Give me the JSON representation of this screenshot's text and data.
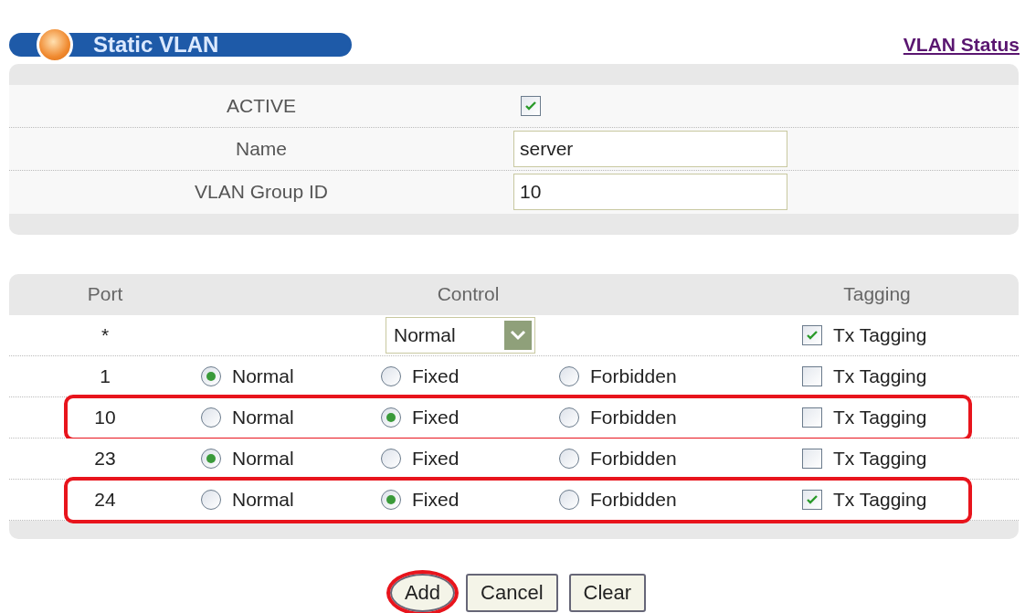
{
  "title": "Static VLAN",
  "status_link": "VLAN Status",
  "settings": [
    {
      "kind": "checkbox",
      "label": "ACTIVE",
      "checked": true
    },
    {
      "kind": "text",
      "label": "Name",
      "value": "server"
    },
    {
      "kind": "text",
      "label": "VLAN Group ID",
      "value": "10"
    }
  ],
  "ports_table": {
    "columns": [
      "Port",
      "Control",
      "Tagging"
    ],
    "rows": [
      {
        "kind": "all",
        "port": "*",
        "select_value": "Normal",
        "tagging": {
          "label": "Tx Tagging",
          "checked": true
        },
        "highlighted": false
      },
      {
        "kind": "port",
        "port": "1",
        "options": [
          {
            "label": "Normal",
            "selected": true
          },
          {
            "label": "Fixed",
            "selected": false
          },
          {
            "label": "Forbidden",
            "selected": false
          }
        ],
        "tagging": {
          "label": "Tx Tagging",
          "checked": false
        },
        "highlighted": false
      },
      {
        "kind": "port",
        "port": "10",
        "options": [
          {
            "label": "Normal",
            "selected": false
          },
          {
            "label": "Fixed",
            "selected": true
          },
          {
            "label": "Forbidden",
            "selected": false
          }
        ],
        "tagging": {
          "label": "Tx Tagging",
          "checked": false
        },
        "highlighted": true
      },
      {
        "kind": "port",
        "port": "23",
        "options": [
          {
            "label": "Normal",
            "selected": true
          },
          {
            "label": "Fixed",
            "selected": false
          },
          {
            "label": "Forbidden",
            "selected": false
          }
        ],
        "tagging": {
          "label": "Tx Tagging",
          "checked": false
        },
        "highlighted": false
      },
      {
        "kind": "port",
        "port": "24",
        "options": [
          {
            "label": "Normal",
            "selected": false
          },
          {
            "label": "Fixed",
            "selected": true
          },
          {
            "label": "Forbidden",
            "selected": false
          }
        ],
        "tagging": {
          "label": "Tx Tagging",
          "checked": true
        },
        "highlighted": true
      }
    ]
  },
  "buttons": [
    {
      "label": "Add",
      "circled": true
    },
    {
      "label": "Cancel",
      "circled": false
    },
    {
      "label": "Clear",
      "circled": false
    }
  ]
}
